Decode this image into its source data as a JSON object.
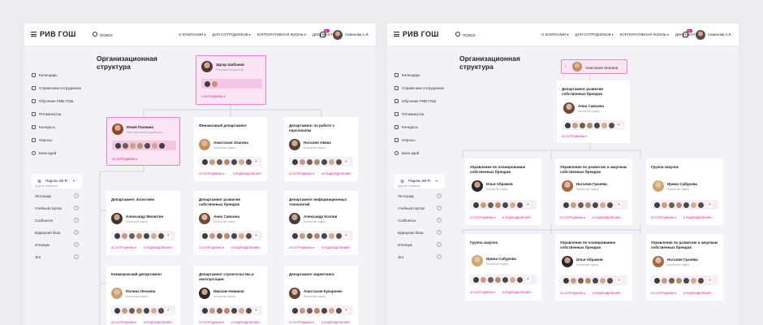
{
  "colors": {
    "accent": "#e6007e",
    "background": "#ececef",
    "page": "#f3f2f7",
    "card": "#ffffff",
    "highlight_fill": "#fbe5f4",
    "highlight_border": "#ee7fc8"
  },
  "app": {
    "logo": "РИВ ГОШ",
    "search_placeholder": "ПОИСК",
    "nav": [
      {
        "label": "О КОМПАНИИ",
        "icon": "chevron-down-icon"
      },
      {
        "label": "ДЛЯ СОТРУДНИКОВ",
        "icon": "chevron-down-icon"
      },
      {
        "label": "КОРПОРАТИВНАЯ ЖИЗНЬ",
        "icon": "chevron-down-icon"
      },
      {
        "label": "ДОКУМЕНТЫ",
        "icon": null
      }
    ],
    "notification_count": "99+",
    "user_name": "Семенова А.Л.",
    "sidebar": [
      {
        "label": "Календарь",
        "icon": "calendar-icon"
      },
      {
        "label": "Справочник сотрудников",
        "icon": "contacts-icon"
      },
      {
        "label": "Обучение РИВ ГОШ",
        "icon": "education-icon"
      },
      {
        "label": "Пятиминутка",
        "icon": "chat-icon"
      },
      {
        "label": "Конкурсы",
        "icon": "trophy-icon"
      },
      {
        "label": "Опросы",
        "icon": "poll-icon"
      },
      {
        "label": "Банк идей",
        "icon": "idea-icon"
      }
    ],
    "wifi_label": "Пароль Wi-Fi",
    "other_services_title": "Другие сервисы",
    "other_services": [
      "Летограф",
      "Учебный портал",
      "Confluence",
      "Буферная база",
      "Итилиум",
      "Jira"
    ],
    "page_title": "Организационная структура"
  },
  "left": {
    "root": {
      "name": "Эдгар Шабанов",
      "title": "Генеральный директор",
      "link": "2 СОТРУДНИКА"
    },
    "depts": [
      {
        "dept": "",
        "name": "Юлия Палкина",
        "title": "Зам. генерального директора",
        "link1": "42 СОТРУДНИКА",
        "link2": ""
      },
      {
        "dept": "Финансовый департамент",
        "name": "Анастасия Злагина",
        "title": "Начальник отдела",
        "link1": "42 СОТРУДНИКА",
        "link2": "5 ПОДРАЗДЕЛЕНИЙ"
      },
      {
        "dept": "Департамент по работе с персоналом",
        "name": "Наталия Ужова",
        "title": "Начальник отдела",
        "link1": "22 СОТРУДНИКА",
        "link2": "10 ПОДРАЗДЕЛЕНИЙ"
      },
      {
        "dept": "Департамент логистики",
        "name": "Александр Милютин",
        "title": "Начальник отдела",
        "link1": "42 СОТРУДНИКА",
        "link2": "3 ПОДРАЗДЕЛЕНИЯ"
      },
      {
        "dept": "Департамент развития собственных брендов",
        "name": "Анна Самсина",
        "title": "Начальник отдела",
        "link1": "22 СОТРУДНИКА",
        "link2": "6 ПОДРАЗДЕЛЕНИЙ"
      },
      {
        "dept": "Департамент информационных технологий",
        "name": "Александр Козлов",
        "title": "Начальник отдела",
        "link1": "22 СОТРУДНИКА",
        "link2": "5 ПОДРАЗДЕЛЕНИЙ"
      },
      {
        "dept": "Коммерческий департамент",
        "name": "Полина Лескина",
        "title": "Начальник отдела",
        "link1": "42 СОТРУДНИКА",
        "link2": "5 ПОДРАЗДЕЛЕНИЙ"
      },
      {
        "dept": "Департамент строительства и эксплуатации",
        "name": "Максим Новиков",
        "title": "Начальник отдела",
        "link1": "22 СОТРУДНИКА",
        "link2": "5 ПОДРАЗДЕЛЕНИЙ"
      },
      {
        "dept": "Департамент маркетинга",
        "name": "Анастасия Кукаренко",
        "title": "Начальник отдела",
        "link1": "22 СОТРУДНИКА",
        "link2": "5 ПОДРАЗДЕЛЕНИЙ"
      }
    ]
  },
  "right": {
    "breadcrumb": "Анастасия Злагина",
    "root": {
      "dept": "Департамент развития собственных брендов",
      "name": "Анна Самсина",
      "title": "Начальник отдела",
      "link": "22 СОТРУДНИКА"
    },
    "depts": [
      {
        "dept": "Управление по планированию собственных брендов",
        "name": "Илья Абрамов",
        "title": "Начальник отдела",
        "link1": "22 СОТРУДНИКА",
        "link2": "6 ПОДРАЗДЕЛЕНИЙ"
      },
      {
        "dept": "Управление по развитию и закупкам собственных брендов",
        "name": "Наталия Грачёва",
        "title": "Начальник отдела",
        "link1": "22 СОТРУДНИКА",
        "link2": "6 ПОДРАЗДЕЛЕНИЙ"
      },
      {
        "dept": "Группа закупок",
        "name": "Ирина Сабурова",
        "title": "Начальник отдела",
        "link1": "22 СОТРУДНИКА",
        "link2": "6 ПОДРАЗДЕЛЕНИЙ"
      },
      {
        "dept": "Группа закупок",
        "name": "Ирина Сабурова",
        "title": "Начальник отдела",
        "link1": "22 СОТРУДНИКА",
        "link2": "6 ПОДРАЗДЕЛЕНИЙ"
      },
      {
        "dept": "Управление по планированию собственных брендов",
        "name": "Илья Абрамов",
        "title": "Начальник отдела",
        "link1": "22 СОТРУДНИКА",
        "link2": "6 ПОДРАЗДЕЛЕНИЙ"
      },
      {
        "dept": "Управление по развитию и закупкам собственных брендов",
        "name": "Наталия Грачёва",
        "title": "Начальник отдела",
        "link1": "22 СОТРУДНИКА",
        "link2": "6 ПОДРАЗДЕЛЕНИЙ"
      }
    ]
  }
}
